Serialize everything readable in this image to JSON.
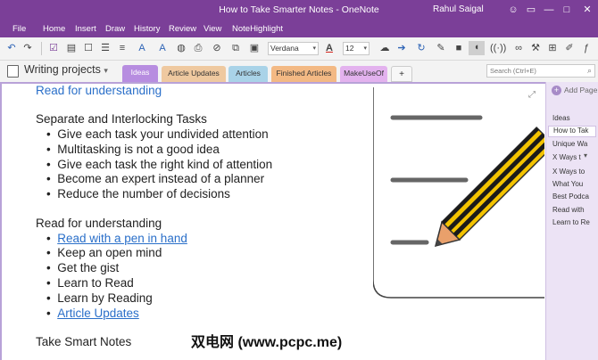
{
  "window": {
    "title": "How to Take Smarter Notes  -  OneNote",
    "user": "Rahul Saigal",
    "buttons": {
      "smiley": "☺",
      "restore_icon": "▭",
      "minimize": "—",
      "maximize": "□",
      "close": "✕"
    }
  },
  "menu": [
    "File",
    "Home",
    "Insert",
    "Draw",
    "History",
    "Review",
    "View",
    "NoteHighlight"
  ],
  "toolbar": {
    "font_name": "Verdana",
    "font_size": "12"
  },
  "notebook": {
    "name": "Writing projects",
    "dropdown": "▾",
    "tabs": [
      {
        "label": "Ideas",
        "color": "#b78de0"
      },
      {
        "label": "Article Updates",
        "color": "#efc9a0"
      },
      {
        "label": "Articles",
        "color": "#a9d3e8"
      },
      {
        "label": "Finished Articles",
        "color": "#f3b984"
      },
      {
        "label": "MakeUseOf",
        "color": "#e3b2ee"
      },
      {
        "label": "+",
        "color": "#f7f7f7"
      }
    ],
    "search_placeholder": "Search (Ctrl+E)"
  },
  "note": {
    "top_link": "Read for understanding",
    "section1_title": "Separate and Interlocking Tasks",
    "section1_items": [
      "Give each task your undivided attention",
      "Multitasking is not a good idea",
      "Give each task the right kind of attention",
      "Become an expert instead of a planner",
      "Reduce the number of decisions"
    ],
    "section2_title": "Read for understanding",
    "section2_items": [
      "Read with a pen in hand",
      "Keep an open mind",
      "Get the gist",
      "Learn to Read",
      "Learn by Reading",
      "Article Updates"
    ],
    "section3_title": "Take Smart Notes"
  },
  "pages": {
    "add_label": "Add Page",
    "items": [
      "Ideas",
      "How to Tak",
      "Unique Wa",
      "X Ways t",
      "X Ways to",
      "What You",
      "Best Podca",
      "Read with",
      "Learn to Re"
    ]
  },
  "watermark": "双电网 (www.pcpc.me)"
}
